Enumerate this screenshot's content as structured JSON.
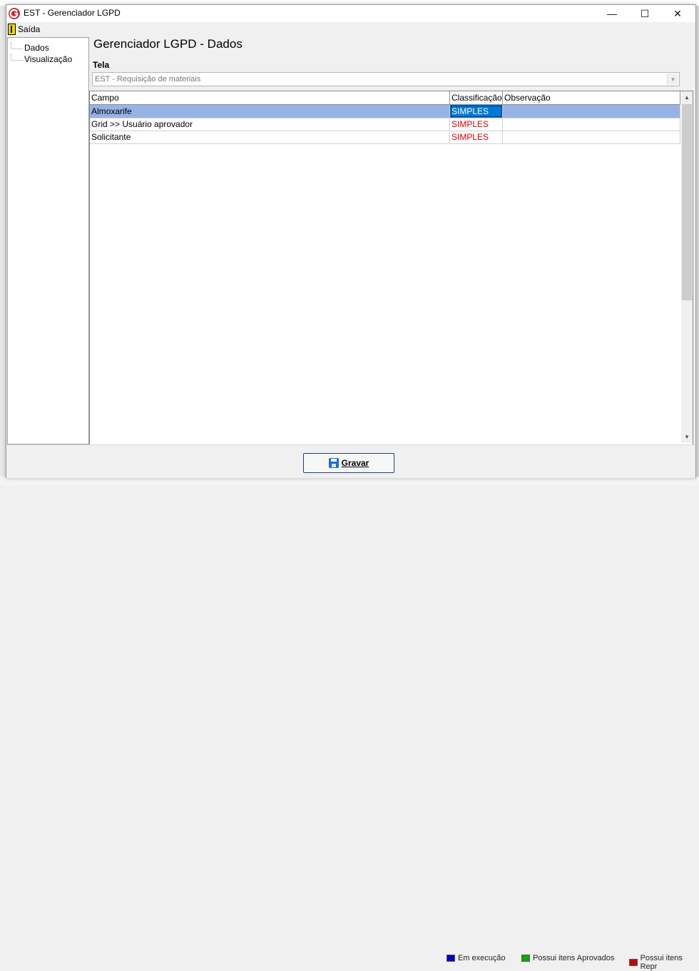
{
  "window": {
    "title": "EST - Gerenciador LGPD",
    "minimize_glyph": "—",
    "maximize_glyph": "☐",
    "close_glyph": "✕"
  },
  "menu": {
    "exit_label": "Saída",
    "exit_icon": "exit-door-icon"
  },
  "tree": {
    "items": [
      {
        "label": "Dados"
      },
      {
        "label": "Visualização"
      }
    ]
  },
  "main": {
    "title": "Gerenciador LGPD - Dados",
    "screen_label": "Tela",
    "screen_select_value": "EST - Requisição de materiais"
  },
  "grid": {
    "columns": [
      "Campo",
      "Classificação",
      "Observação"
    ],
    "rows": [
      {
        "campo": "Almoxarife",
        "classificacao": "SIMPLES",
        "observacao": "",
        "selected": true
      },
      {
        "campo": "Grid >> Usuário aprovador",
        "classificacao": "SIMPLES",
        "observacao": ""
      },
      {
        "campo": "Solicitante",
        "classificacao": "SIMPLES",
        "observacao": ""
      }
    ],
    "classification_color": "#e00000",
    "selection_color": "#97b3e6"
  },
  "footer": {
    "save_label": "Gravar",
    "save_icon": "floppy-disk-icon"
  },
  "background": {
    "legend": [
      {
        "label": "Em execução",
        "color": "#0000c8"
      },
      {
        "label": "Possui itens Aprovados",
        "color": "#00b000"
      },
      {
        "label": "Possui itens Repr",
        "color": "#c80000"
      }
    ]
  }
}
